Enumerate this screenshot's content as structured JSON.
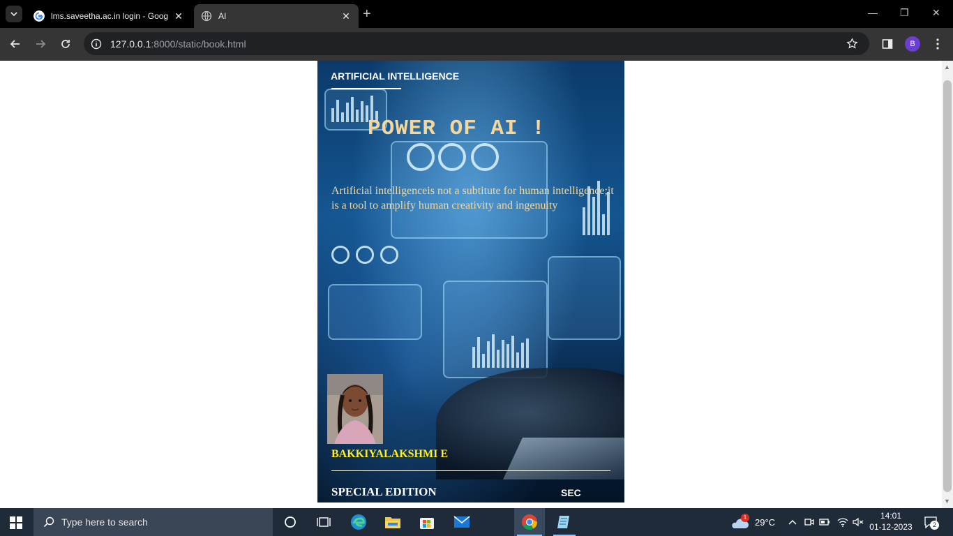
{
  "browser": {
    "tabs": [
      {
        "title": "lms.saveetha.ac.in login - Goog",
        "active": false
      },
      {
        "title": "AI",
        "active": true
      }
    ],
    "address": {
      "host": "127.0.0.1",
      "path": ":8000/static/book.html"
    },
    "profile_initial": "B"
  },
  "cover": {
    "series": "ARTIFICIAL INTELLIGENCE",
    "title": "POWER OF AI !",
    "quote": "Artificial intelligenceis not a subtitute for human intelligence;it is a tool to amplify human creativity and ingenuity",
    "author": "BAKKIYALAKSHMI E",
    "edition": "SPECIAL EDITION",
    "publisher": "SEC"
  },
  "taskbar": {
    "search_placeholder": "Type here to search",
    "weather": "29°C",
    "weather_badge": "1",
    "time": "14:01",
    "date": "01-12-2023",
    "notifications": "2"
  }
}
